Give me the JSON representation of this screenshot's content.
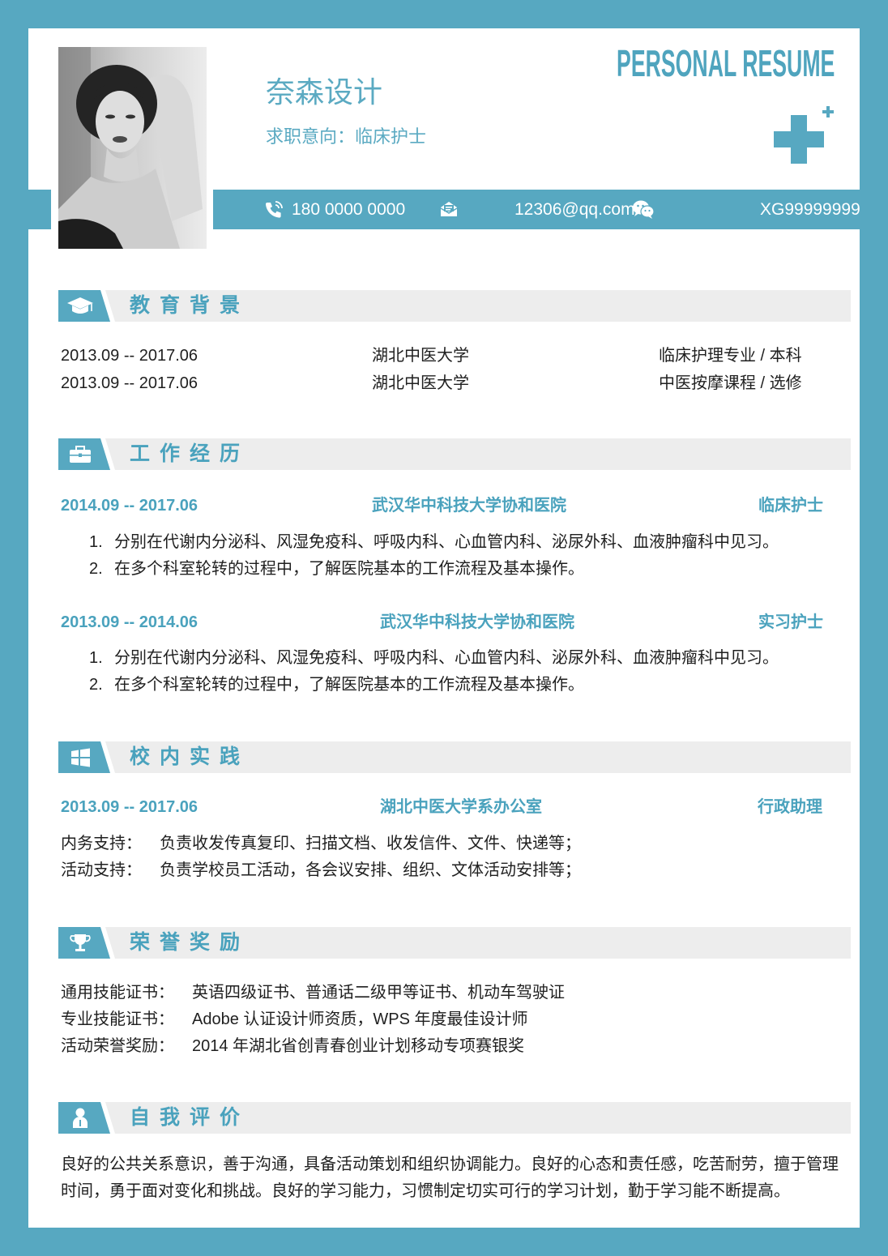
{
  "header": {
    "title_en": "PERSONAL RESUME",
    "name": "奈森设计",
    "objective": "求职意向：临床护士"
  },
  "contact": {
    "phone": "180 0000 0000",
    "email": "12306@qq.com",
    "wechat": "XG99999999"
  },
  "education": {
    "title": "教育背景",
    "rows": [
      {
        "period": "2013.09 -- 2017.06",
        "school": "湖北中医大学",
        "major": "临床护理专业 / 本科"
      },
      {
        "period": "2013.09 -- 2017.06",
        "school": "湖北中医大学",
        "major": "中医按摩课程 / 选修"
      }
    ]
  },
  "work": {
    "title": "工作经历",
    "entries": [
      {
        "period": "2014.09 -- 2017.06",
        "org": "武汉华中科技大学协和医院",
        "role": "临床护士",
        "items": [
          "分别在代谢内分泌科、风湿免疫科、呼吸内科、心血管内科、泌尿外科、血液肿瘤科中见习。",
          "在多个科室轮转的过程中，了解医院基本的工作流程及基本操作。"
        ]
      },
      {
        "period": "2013.09 -- 2014.06",
        "org": "武汉华中科技大学协和医院",
        "role": "实习护士",
        "items": [
          "分别在代谢内分泌科、风湿免疫科、呼吸内科、心血管内科、泌尿外科、血液肿瘤科中见习。",
          "在多个科室轮转的过程中，了解医院基本的工作流程及基本操作。"
        ]
      }
    ]
  },
  "campus": {
    "title": "校内实践",
    "entries": [
      {
        "period": "2013.09 -- 2017.06",
        "org": "湖北中医大学系办公室",
        "role": "行政助理",
        "rows": [
          {
            "label": "内务支持：",
            "text": "负责收发传真复印、扫描文档、收发信件、文件、快递等；"
          },
          {
            "label": "活动支持：",
            "text": "负责学校员工活动，各会议安排、组织、文体活动安排等；"
          }
        ]
      }
    ]
  },
  "honors": {
    "title": "荣誉奖励",
    "rows": [
      {
        "label": "通用技能证书：",
        "text": "英语四级证书、普通话二级甲等证书、机动车驾驶证"
      },
      {
        "label": "专业技能证书：",
        "text": "Adobe 认证设计师资质，WPS 年度最佳设计师"
      },
      {
        "label": "活动荣誉奖励：",
        "text": "2014 年湖北省创青春创业计划移动专项赛银奖"
      }
    ]
  },
  "self_evaluation": {
    "title": "自我评价",
    "lines": [
      "良好的公共关系意识，善于沟通，具备活动策划和组织协调能力。良好的心态和责任感，吃苦耐劳，擅于管理",
      "时间，勇于面对变化和挑战。良好的学习能力，习惯制定切实可行的学习计划，勤于学习能不断提高。"
    ]
  },
  "icons": {
    "header": "medical-plus-icon",
    "phone": "phone-icon",
    "email": "mail-icon",
    "wechat": "wechat-icon",
    "education": "graduation-cap-icon",
    "work": "briefcase-icon",
    "campus": "windows-grid-icon",
    "honors": "trophy-icon",
    "self_evaluation": "person-icon"
  },
  "colors": {
    "accent": "#57A8C1",
    "accent_text": "#4AA2BD",
    "section_bar": "#EDEDED",
    "body_text": "#1F1F1F",
    "background": "#FFFFFF"
  }
}
